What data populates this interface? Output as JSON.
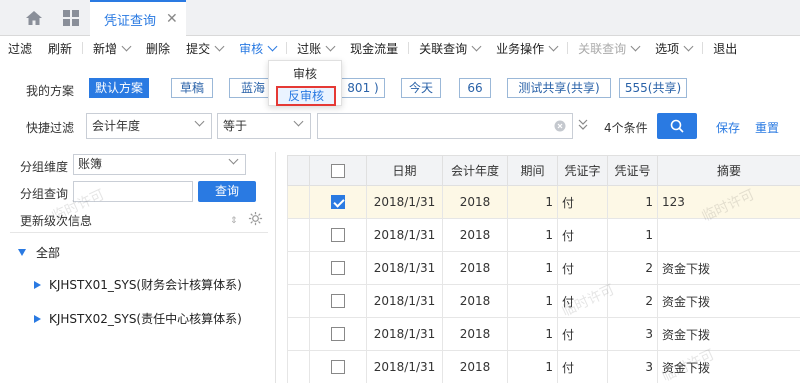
{
  "tabs": {
    "active_label": "凭证查询"
  },
  "toolbar": [
    {
      "label": "过滤",
      "chev": false
    },
    {
      "label": "刷新",
      "chev": false
    },
    {
      "label": "新增",
      "chev": true
    },
    {
      "label": "删除",
      "chev": false
    },
    {
      "label": "提交",
      "chev": true
    },
    {
      "label": "审核",
      "chev": true,
      "active": true
    },
    {
      "label": "过账",
      "chev": true
    },
    {
      "label": "现金流量",
      "chev": false
    },
    {
      "label": "关联查询",
      "chev": true
    },
    {
      "label": "业务操作",
      "chev": true
    },
    {
      "label": "关联查询",
      "chev": true,
      "disabled": true
    },
    {
      "label": "选项",
      "chev": true
    },
    {
      "label": "退出",
      "chev": false
    }
  ],
  "audit_menu": {
    "item1": "审核",
    "item2": "反审核"
  },
  "schemes": {
    "label": "我的方案",
    "items": [
      "默认方案",
      "草稿",
      "蓝海",
      "801 )",
      "今天",
      "66",
      "测试共享(共享)",
      "555(共享)"
    ]
  },
  "filter": {
    "label": "快捷过滤",
    "field": "会计年度",
    "op": "等于",
    "value": "",
    "conditions": "4个条件",
    "save": "保存",
    "reset": "重置"
  },
  "left_panel": {
    "group_dim_label": "分组维度",
    "group_dim_value": "账簿",
    "group_query_label": "分组查询",
    "query_button": "查询",
    "update_info": "更新级次信息",
    "tree_root": "全部",
    "tree_items": [
      "KJHSTX01_SYS(财务会计核算体系)",
      "KJHSTX02_SYS(责任中心核算体系)"
    ]
  },
  "table": {
    "headers": [
      "日期",
      "会计年度",
      "期间",
      "凭证字",
      "凭证号",
      "摘要"
    ],
    "rows": [
      {
        "checked": true,
        "date": "2018/1/31",
        "year": "2018",
        "period": "1",
        "word": "付",
        "no": "1",
        "summary": "123"
      },
      {
        "checked": false,
        "date": "2018/1/31",
        "year": "2018",
        "period": "1",
        "word": "付",
        "no": "1",
        "summary": ""
      },
      {
        "checked": false,
        "date": "2018/1/31",
        "year": "2018",
        "period": "1",
        "word": "付",
        "no": "2",
        "summary": "资金下拨"
      },
      {
        "checked": false,
        "date": "2018/1/31",
        "year": "2018",
        "period": "1",
        "word": "付",
        "no": "2",
        "summary": "资金下拨"
      },
      {
        "checked": false,
        "date": "2018/1/31",
        "year": "2018",
        "period": "1",
        "word": "付",
        "no": "3",
        "summary": "资金下拨"
      },
      {
        "checked": false,
        "date": "2018/1/31",
        "year": "2018",
        "period": "1",
        "word": "付",
        "no": "3",
        "summary": "资金下拨"
      }
    ]
  },
  "watermark": "临时许可",
  "colors": {
    "accent": "#2a7ae2",
    "highlight_border": "#e53935"
  }
}
